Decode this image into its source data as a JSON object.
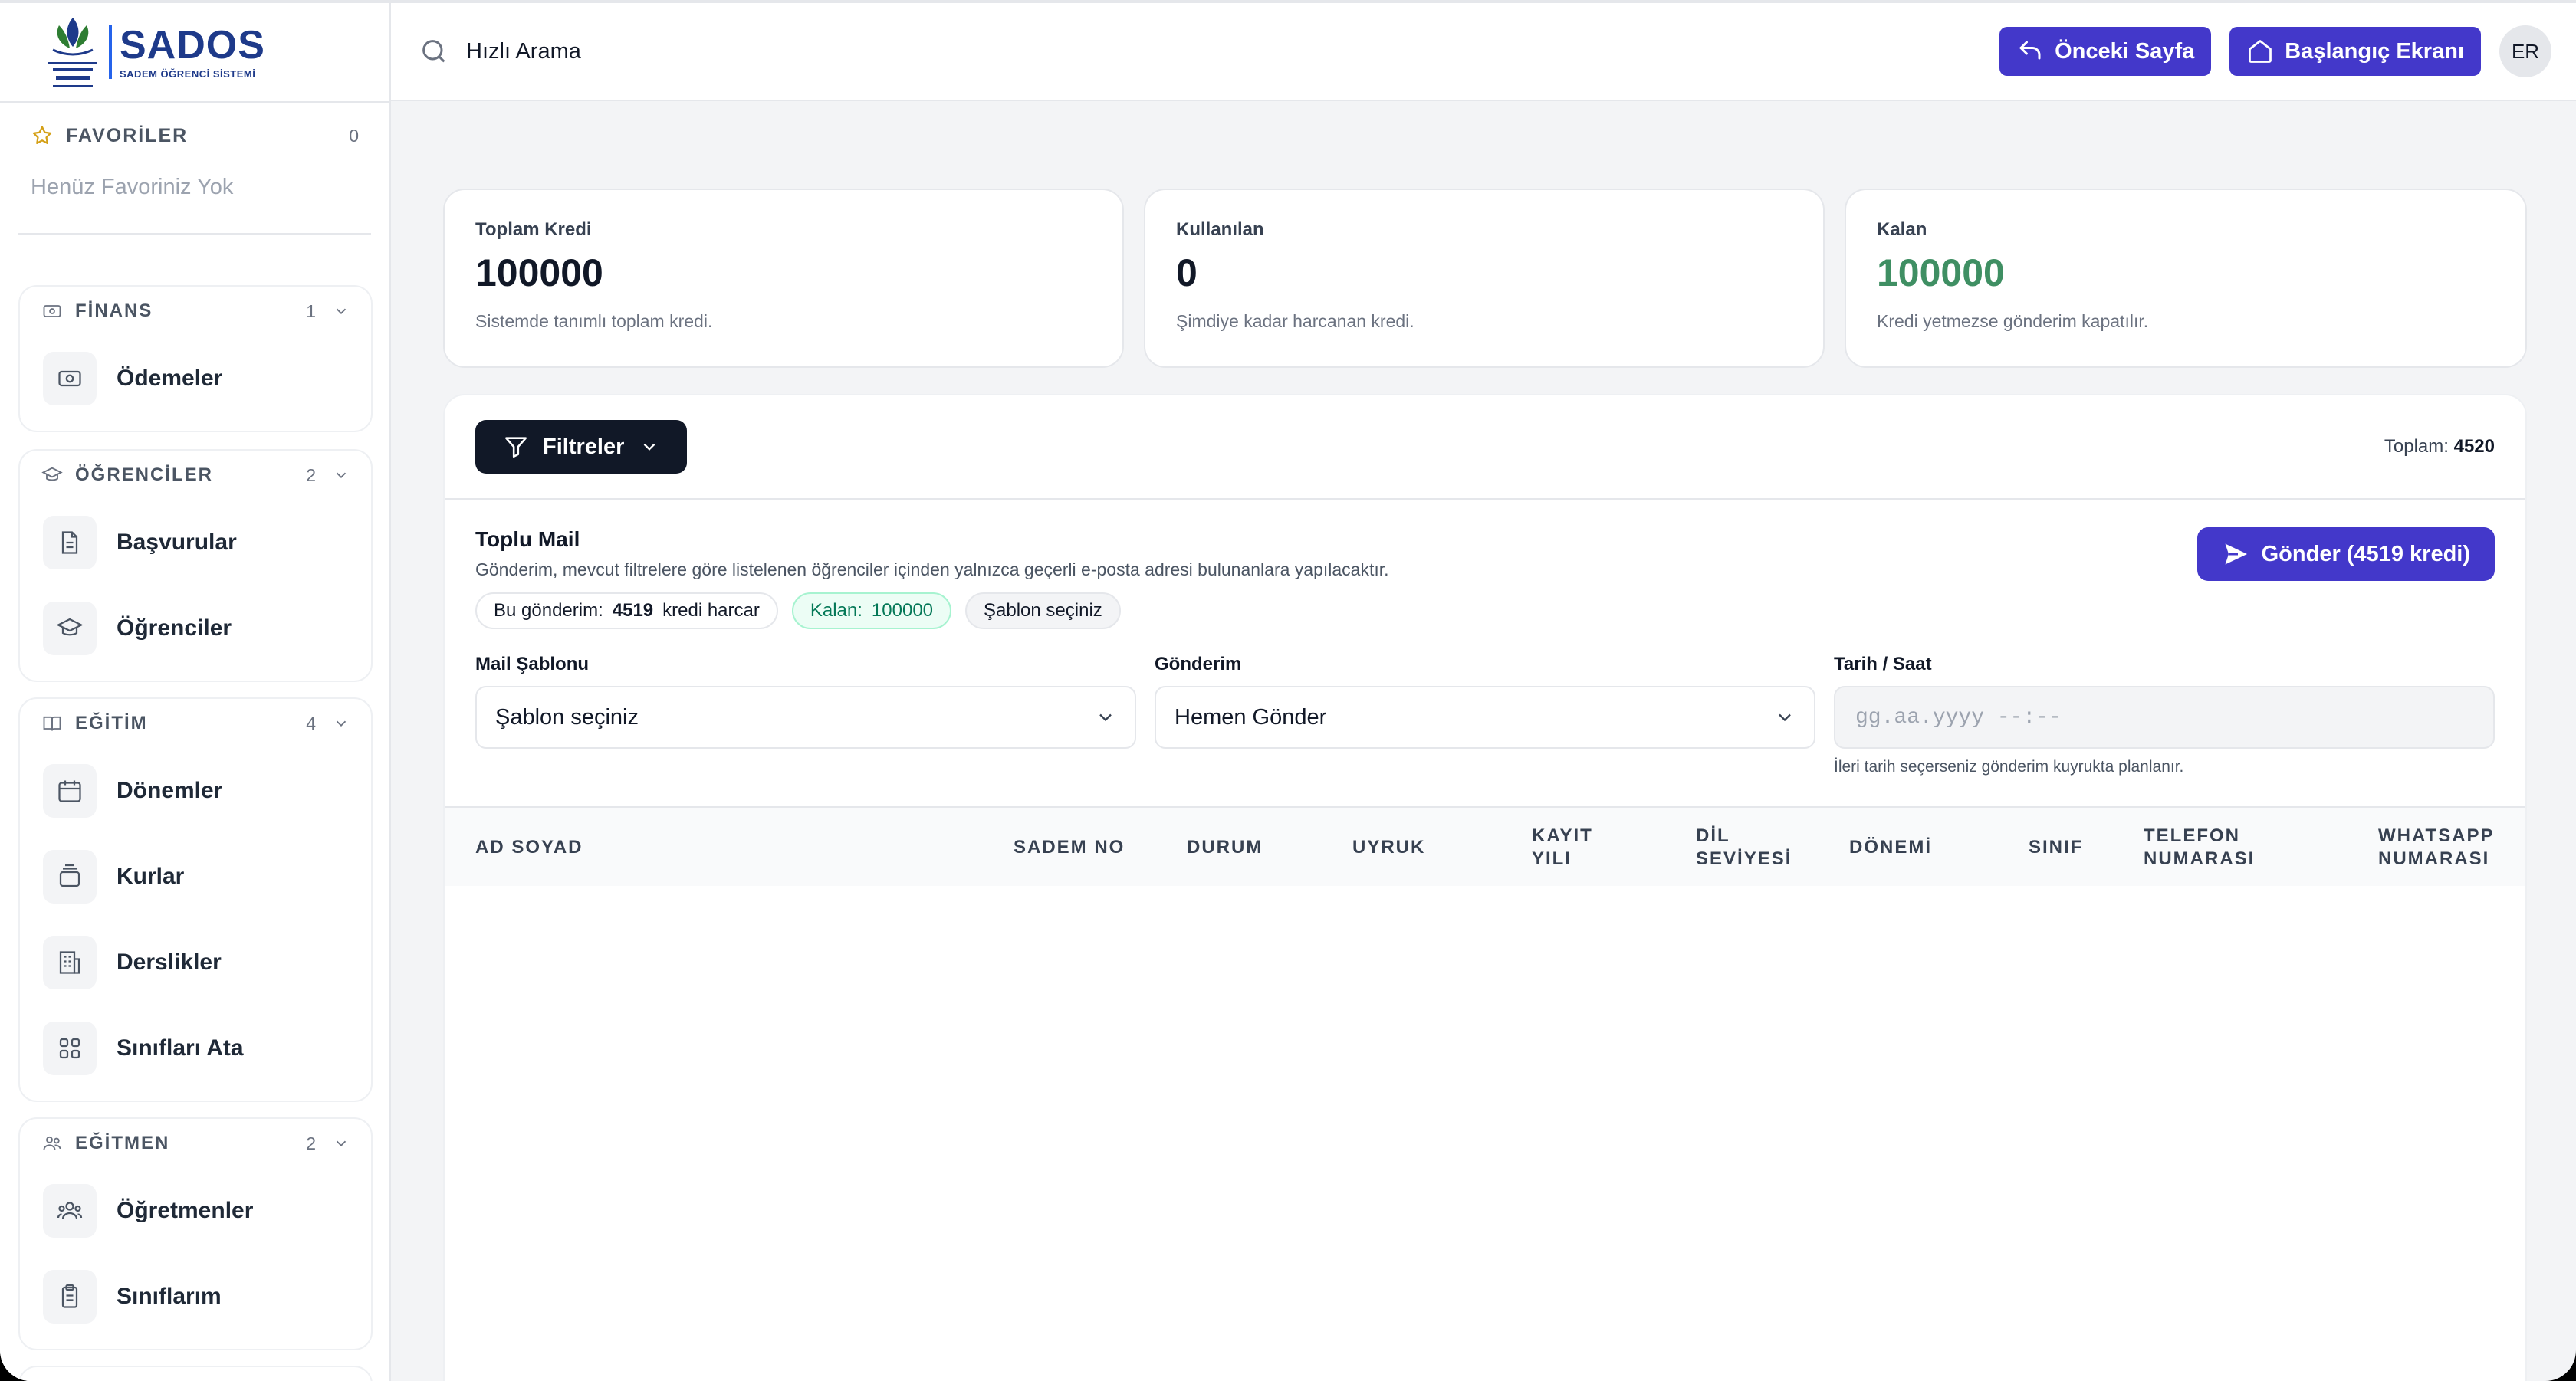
{
  "app": {
    "logo_title": "SADOS",
    "logo_sub": "SADEM ÖĞRENCİ SİSTEMİ"
  },
  "sidebar": {
    "favorites": {
      "title": "FAVORİLER",
      "count": "0",
      "empty": "Henüz Favoriniz Yok"
    },
    "groups": [
      {
        "title": "FİNANS",
        "count": "1",
        "icon": "money-icon",
        "items": [
          {
            "label": "Ödemeler",
            "icon": "banknote-icon"
          }
        ]
      },
      {
        "title": "ÖĞRENCİLER",
        "count": "2",
        "icon": "graduation-cap-icon",
        "items": [
          {
            "label": "Başvurular",
            "icon": "document-icon"
          },
          {
            "label": "Öğrenciler",
            "icon": "graduation-cap-icon"
          }
        ]
      },
      {
        "title": "EĞİTİM",
        "count": "4",
        "icon": "book-icon",
        "items": [
          {
            "label": "Dönemler",
            "icon": "calendar-icon"
          },
          {
            "label": "Kurlar",
            "icon": "layers-icon"
          },
          {
            "label": "Derslikler",
            "icon": "building-icon"
          },
          {
            "label": "Sınıfları Ata",
            "icon": "grid-icon"
          }
        ]
      },
      {
        "title": "EĞİTMEN",
        "count": "2",
        "icon": "users-icon",
        "items": [
          {
            "label": "Öğretmenler",
            "icon": "users-icon"
          },
          {
            "label": "Sınıflarım",
            "icon": "clipboard-icon"
          }
        ]
      }
    ]
  },
  "header": {
    "search_placeholder": "Hızlı Arama",
    "back_label": "Önceki Sayfa",
    "home_label": "Başlangıç Ekranı",
    "avatar": "ER"
  },
  "stats": [
    {
      "label": "Toplam Kredi",
      "value": "100000",
      "desc": "Sistemde tanımlı toplam kredi."
    },
    {
      "label": "Kullanılan",
      "value": "0",
      "desc": "Şimdiye kadar harcanan kredi."
    },
    {
      "label": "Kalan",
      "value": "100000",
      "desc": "Kredi yetmezse gönderim kapatılır."
    }
  ],
  "panel": {
    "filter_label": "Filtreler",
    "total_label": "Toplam:",
    "total_value": "4520",
    "mail_title": "Toplu Mail",
    "mail_desc": "Gönderim, mevcut filtrelere göre listelenen öğrenciler içinden yalnızca geçerli e-posta adresi bulunanlara yapılacaktır.",
    "send_label": "Gönder (4519 kredi)",
    "chip1_prefix": "Bu gönderim:",
    "chip1_value": "4519",
    "chip1_suffix": "kredi harcar",
    "chip2_prefix": "Kalan:",
    "chip2_value": "100000",
    "chip3": "Şablon seçiniz",
    "template_label": "Mail Şablonu",
    "template_value": "Şablon seçiniz",
    "send_mode_label": "Gönderim",
    "send_mode_value": "Hemen Gönder",
    "datetime_label": "Tarih / Saat",
    "datetime_placeholder": "gg.aa.yyyy --:--",
    "datetime_hint": "İleri tarih seçerseniz gönderim kuyrukta planlanır."
  },
  "table": {
    "columns": [
      "AD SOYAD",
      "SADEM NO",
      "DURUM",
      "UYRUK",
      "KAYIT YILI",
      "DİL SEVİYESİ",
      "DÖNEMİ",
      "SINIF",
      "TELEFON NUMARASI",
      "WHATSAPP NUMARASI"
    ]
  },
  "colors": {
    "primary": "#4338ca",
    "dark": "#111827",
    "green": "#3f8f63",
    "brand": "#1e3a8a"
  }
}
